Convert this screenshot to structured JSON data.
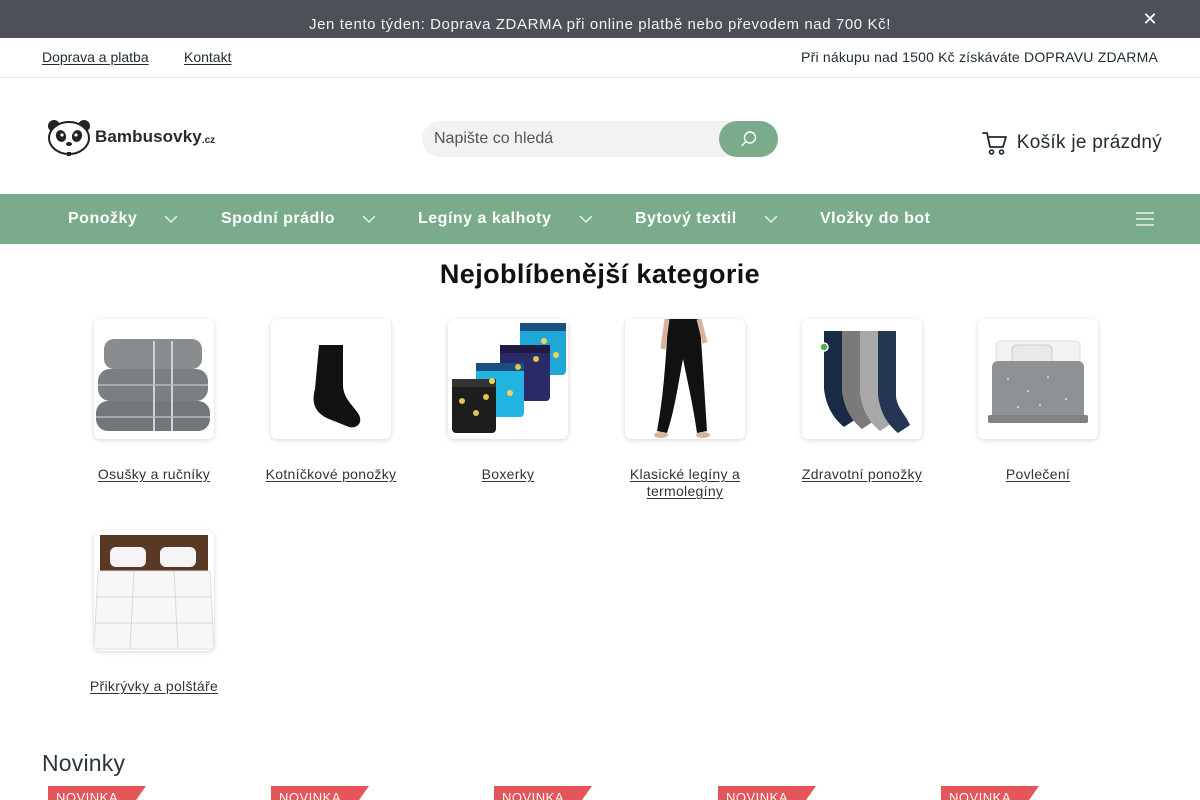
{
  "promo": {
    "text": "Jen tento týden: Doprava ZDARMA při online platbě nebo převodem nad 700 Kč!",
    "close_label": "✕"
  },
  "utility": {
    "links": [
      "Doprava a platba",
      "Kontakt"
    ],
    "right_text": "Při  nákupu nad 1500 Kč získáváte DOPRAVU ZDARMA"
  },
  "header": {
    "logo_text": "Bambusovky",
    "logo_tld": ".cz",
    "search_placeholder": "Napište co hledá",
    "cart_label": "Košík je prázdný"
  },
  "nav": {
    "items": [
      {
        "label": "Ponožky",
        "has_dropdown": true
      },
      {
        "label": "Spodní prádlo",
        "has_dropdown": true
      },
      {
        "label": "Legíny a kalhoty",
        "has_dropdown": true
      },
      {
        "label": "Bytový textil",
        "has_dropdown": true
      },
      {
        "label": "Vložky do bot",
        "has_dropdown": false
      }
    ]
  },
  "categories": {
    "title": "Nejoblíbenější kategorie",
    "items": [
      {
        "label": "Osušky a ručníky",
        "icon": "towels-image"
      },
      {
        "label": "Kotníčkové ponožky",
        "icon": "ankle-sock-image"
      },
      {
        "label": "Boxerky",
        "icon": "boxers-image"
      },
      {
        "label": "Klasické legíny a termolegíny",
        "icon": "leggings-image"
      },
      {
        "label": "Zdravotní ponožky",
        "icon": "health-socks-image"
      },
      {
        "label": "Povlečení",
        "icon": "bedding-image"
      },
      {
        "label": "Přikrývky a polštáře",
        "icon": "duvet-image"
      }
    ]
  },
  "novinky": {
    "title": "Novinky",
    "badges": [
      "NOVINKA",
      "NOVINKA",
      "NOVINKA",
      "NOVINKA",
      "NOVINKA"
    ]
  },
  "colors": {
    "promo_bg": "#4b5157",
    "nav_bg": "#7aab8a",
    "badge_bg": "#e5565a"
  }
}
